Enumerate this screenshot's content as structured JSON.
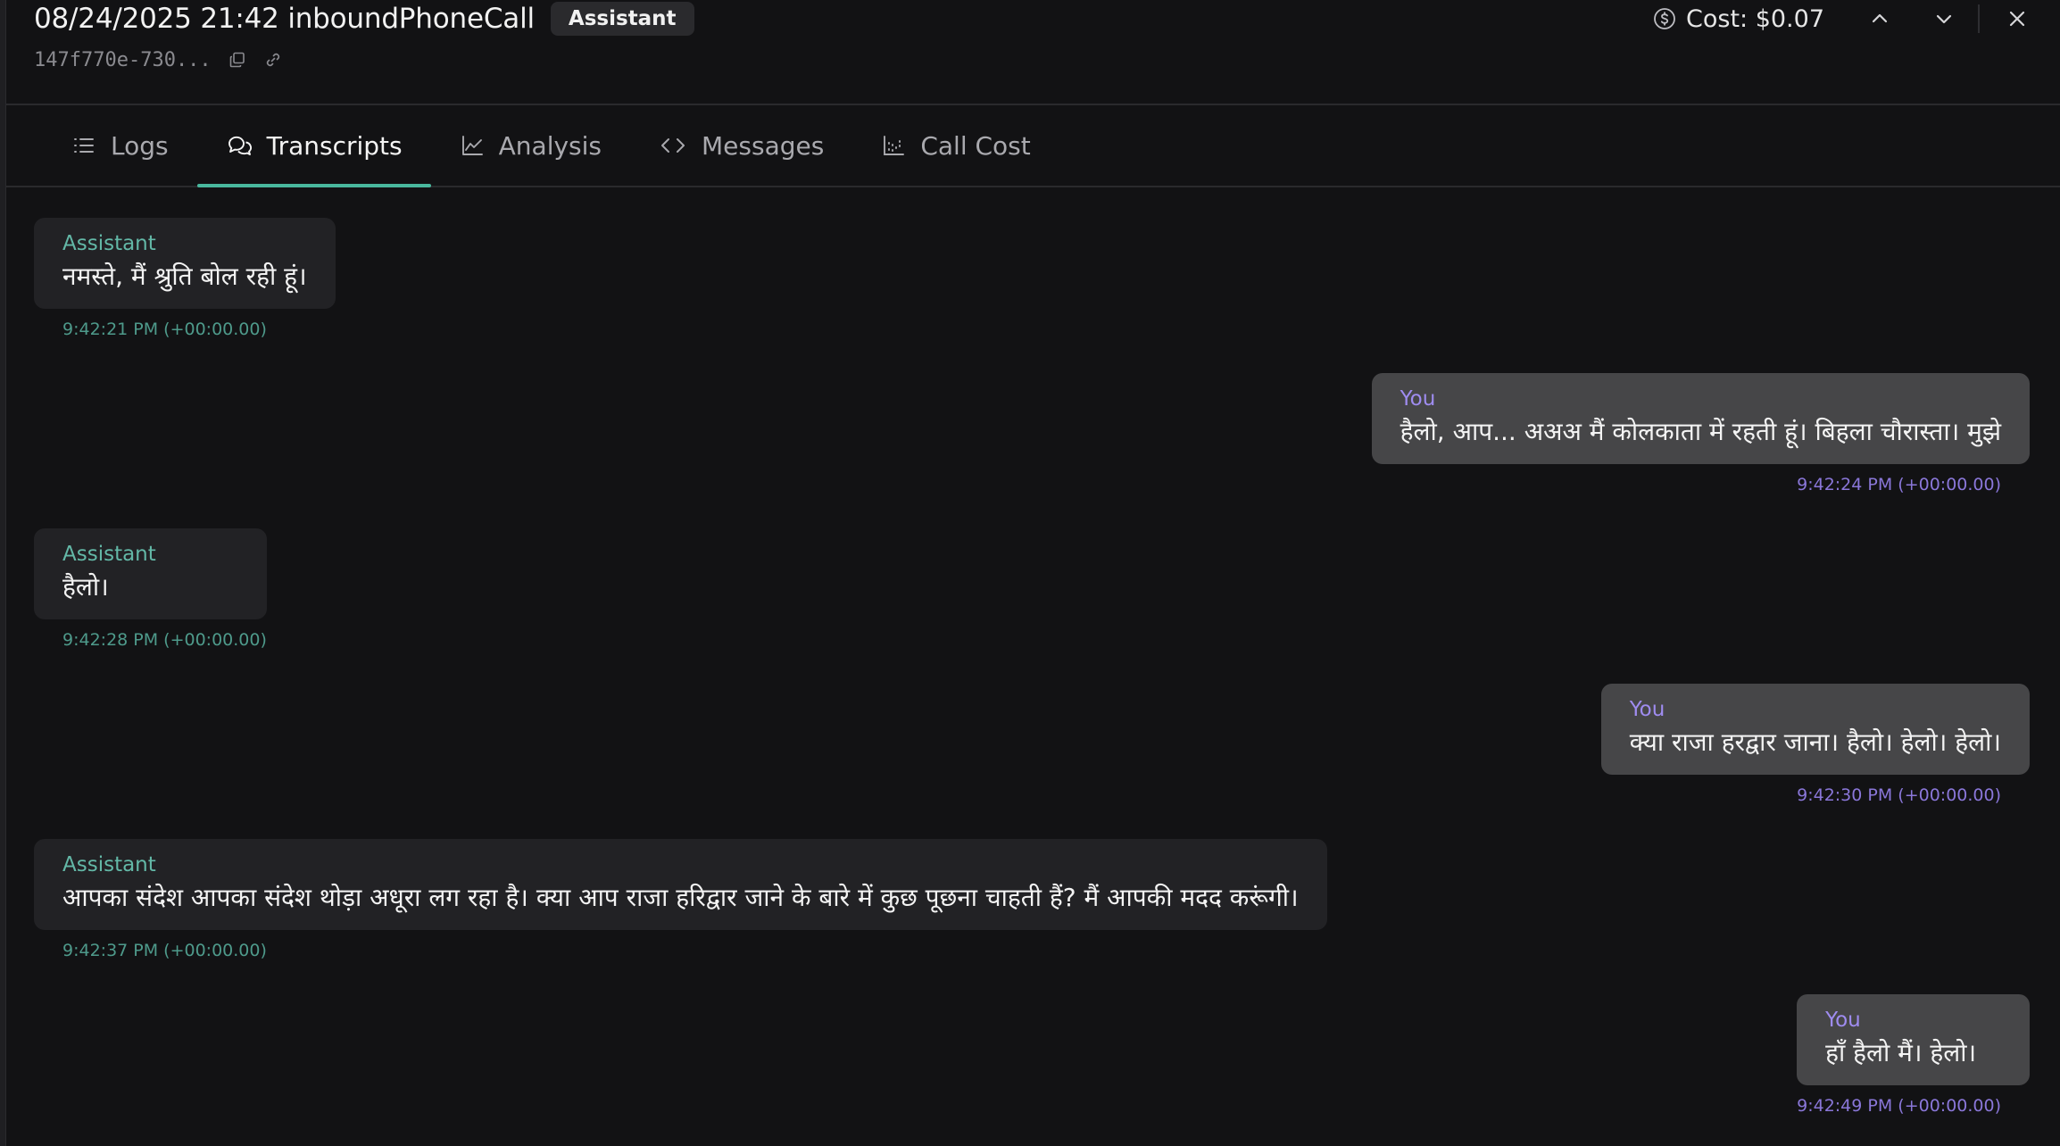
{
  "header": {
    "title": "08/24/2025 21:42 inboundPhoneCall",
    "badge": "Assistant",
    "call_id": "147f770e-730...",
    "cost": "Cost: $0.07"
  },
  "tabs": [
    {
      "label": "Logs",
      "icon": "list-icon"
    },
    {
      "label": "Transcripts",
      "icon": "chat-icon"
    },
    {
      "label": "Analysis",
      "icon": "chart-line-icon"
    },
    {
      "label": "Messages",
      "icon": "code-icon"
    },
    {
      "label": "Call Cost",
      "icon": "chart-scatter-icon"
    }
  ],
  "messages": [
    {
      "role": "assistant",
      "speaker": "Assistant",
      "text": "नमस्ते, मैं श्रुति बोल रही हूं।",
      "time": "9:42:21 PM (+00:00.00)"
    },
    {
      "role": "user",
      "speaker": "You",
      "text": "हैलो, आप... अअअ मैं कोलकाता में रहती हूं। बिहला चौरास्ता। मुझे",
      "time": "9:42:24 PM (+00:00.00)"
    },
    {
      "role": "assistant",
      "speaker": "Assistant",
      "text": "हैलो।",
      "time": "9:42:28 PM (+00:00.00)"
    },
    {
      "role": "user",
      "speaker": "You",
      "text": "क्या राजा हरद्वार जाना। हैलो। हेलो। हेलो।",
      "time": "9:42:30 PM (+00:00.00)"
    },
    {
      "role": "assistant",
      "speaker": "Assistant",
      "text": "आपका संदेश आपका संदेश थोड़ा अधूरा लग रहा है। क्या आप राजा हरिद्वार जाने के बारे में कुछ पूछना चाहती हैं? मैं आपकी मदद करूंगी।",
      "time": "9:42:37 PM (+00:00.00)"
    },
    {
      "role": "user",
      "speaker": "You",
      "text": "हाँ हैलो मैं। हेलो।",
      "time": "9:42:49 PM (+00:00.00)"
    }
  ],
  "colors": {
    "background": "#121214",
    "accent": "#49b89e",
    "assistant_label": "#63b8a7",
    "user_label": "#9f8cf0"
  }
}
